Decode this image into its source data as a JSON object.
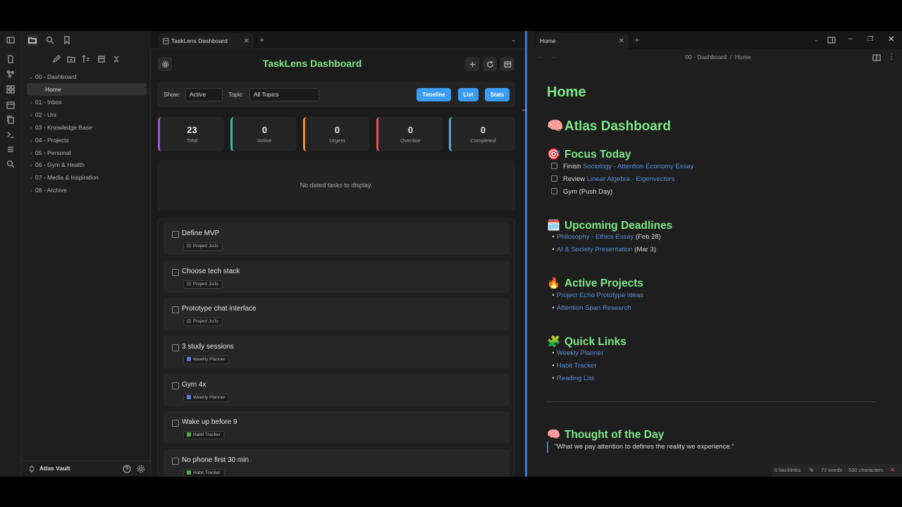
{
  "explorer": {
    "folders": [
      {
        "label": "00 - Dashboard",
        "expanded": true
      },
      {
        "label": "01 - Inbox",
        "expanded": false
      },
      {
        "label": "02 - Uni",
        "expanded": false
      },
      {
        "label": "03 - Knowledge Base",
        "expanded": false
      },
      {
        "label": "04 - Projects",
        "expanded": false
      },
      {
        "label": "05 - Personal",
        "expanded": false
      },
      {
        "label": "06 - Gym & Health",
        "expanded": false
      },
      {
        "label": "07 - Media & Inspiration",
        "expanded": false
      },
      {
        "label": "08 - Archive",
        "expanded": false
      }
    ],
    "active_file": "Home",
    "vault_name": "Atlas Vault"
  },
  "left_pane": {
    "tab_title": "TaskLens Dashboard",
    "dashboard": {
      "title": "TaskLens Dashboard",
      "show_label": "Show:",
      "show_value": "Active",
      "topic_label": "Topic:",
      "topic_value": "All Topics",
      "view_buttons": [
        "Timeline",
        "List",
        "Stats"
      ],
      "stats": [
        {
          "value": "23",
          "label": "Total",
          "color": "#9b59d0"
        },
        {
          "value": "0",
          "label": "Active",
          "color": "#3fb9a0"
        },
        {
          "value": "0",
          "label": "Urgent",
          "color": "#e8923a"
        },
        {
          "value": "0",
          "label": "Overdue",
          "color": "#e0514f"
        },
        {
          "value": "0",
          "label": "Completed",
          "color": "#5aa9d6"
        }
      ],
      "empty_message": "No dated tasks to display.",
      "tasks": [
        {
          "title": "Define MVP",
          "tag": "Project JoJo",
          "tag_color": "#4a4a4a"
        },
        {
          "title": "Choose tech stack",
          "tag": "Project JoJo",
          "tag_color": "#4a4a4a"
        },
        {
          "title": "Prototype chat interface",
          "tag": "Project JoJo",
          "tag_color": "#4a4a4a"
        },
        {
          "title": "3 study sessions",
          "tag": "Weekly Planner",
          "tag_color": "#5b7fd6"
        },
        {
          "title": "Gym 4x",
          "tag": "Weekly Planner",
          "tag_color": "#5b7fd6"
        },
        {
          "title": "Wake up before 9",
          "tag": "Habit Tracker",
          "tag_color": "#4caf50"
        },
        {
          "title": "No phone first 30 min",
          "tag": "Habit Tracker",
          "tag_color": "#4caf50"
        }
      ]
    }
  },
  "right_pane": {
    "tab_title": "Home",
    "breadcrumb": [
      "00 - Dashboard",
      "Home"
    ],
    "note": {
      "title": "Home",
      "h1_emoji": "🧠",
      "h1": "Atlas Dashboard",
      "focus": {
        "emoji": "🎯",
        "heading": "Focus Today",
        "items": [
          {
            "prefix": "Finish",
            "link": "Sociology - Attention Economy Essay"
          },
          {
            "prefix": "Review",
            "link": "Linear Algebra - Eigenvectors"
          },
          {
            "prefix": "Gym (Push Day)",
            "link": ""
          }
        ]
      },
      "deadlines": {
        "emoji": "🗓️",
        "heading": "Upcoming Deadlines",
        "items": [
          {
            "link": "Philosophy - Ethics Essay",
            "suffix": "(Feb 28)"
          },
          {
            "link": "AI & Society Presentation",
            "suffix": "(Mar 3)"
          }
        ]
      },
      "projects": {
        "emoji": "🔥",
        "heading": "Active Projects",
        "items": [
          "Project Echo Prototype Ideas",
          "Attention Span Research"
        ]
      },
      "quicklinks": {
        "emoji": "🧩",
        "heading": "Quick Links",
        "items": [
          "Weekly Planner",
          "Habit Tracker",
          "Reading List"
        ]
      },
      "thought": {
        "emoji": "🧠",
        "heading": "Thought of the Day",
        "quote": "“What we pay attention to defines the reality we experience.”"
      }
    },
    "status": {
      "backlinks": "0 backlinks",
      "words": "73 words",
      "chars": "530 characters"
    }
  }
}
